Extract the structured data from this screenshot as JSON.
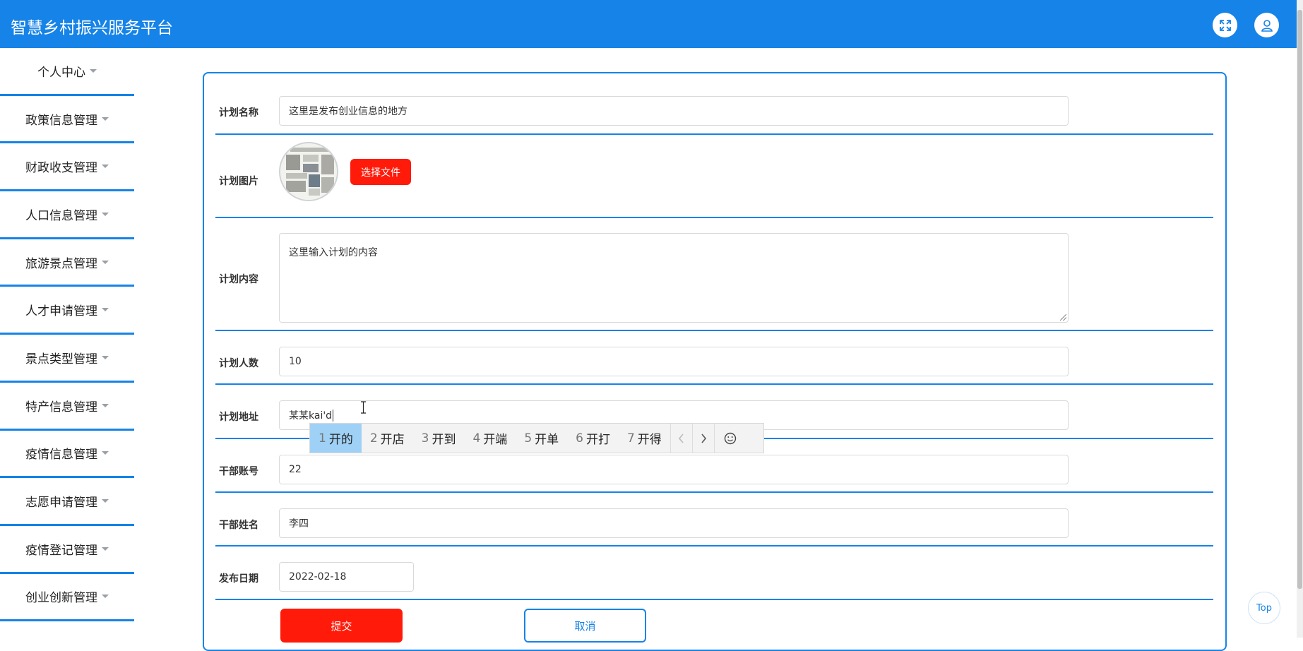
{
  "app": {
    "title": "智慧乡村振兴服务平台"
  },
  "header": {
    "icons": [
      "fullscreen-icon",
      "user-icon"
    ]
  },
  "sidebar": {
    "items": [
      {
        "label": "个人中心"
      },
      {
        "label": "政策信息管理"
      },
      {
        "label": "财政收支管理"
      },
      {
        "label": "人口信息管理"
      },
      {
        "label": "旅游景点管理"
      },
      {
        "label": "人才申请管理"
      },
      {
        "label": "景点类型管理"
      },
      {
        "label": "特产信息管理"
      },
      {
        "label": "疫情信息管理"
      },
      {
        "label": "志愿申请管理"
      },
      {
        "label": "疫情登记管理"
      },
      {
        "label": "创业创新管理"
      }
    ]
  },
  "form": {
    "plan_name": {
      "label": "计划名称",
      "value": "这里是发布创业信息的地方"
    },
    "plan_image": {
      "label": "计划图片",
      "button": "选择文件"
    },
    "plan_content": {
      "label": "计划内容",
      "value": "这里输入计划的内容"
    },
    "plan_count": {
      "label": "计划人数",
      "value": "10"
    },
    "plan_address": {
      "label": "计划地址",
      "value": "某某kai'd"
    },
    "cadre_account": {
      "label": "干部账号",
      "value": "22"
    },
    "cadre_name": {
      "label": "干部姓名",
      "value": "李四"
    },
    "publish_date": {
      "label": "发布日期",
      "value": "2022-02-18"
    },
    "submit": "提交",
    "cancel": "取消"
  },
  "ime": {
    "candidates": [
      {
        "num": "1",
        "text": "开的"
      },
      {
        "num": "2",
        "text": "开店"
      },
      {
        "num": "3",
        "text": "开到"
      },
      {
        "num": "4",
        "text": "开端"
      },
      {
        "num": "5",
        "text": "开单"
      },
      {
        "num": "6",
        "text": "开打"
      },
      {
        "num": "7",
        "text": "开得"
      }
    ]
  },
  "scroll_top": "Top",
  "colors": {
    "primary": "#1683e8",
    "danger": "#ff1a0a",
    "ime_highlight": "#9fd1f6"
  }
}
